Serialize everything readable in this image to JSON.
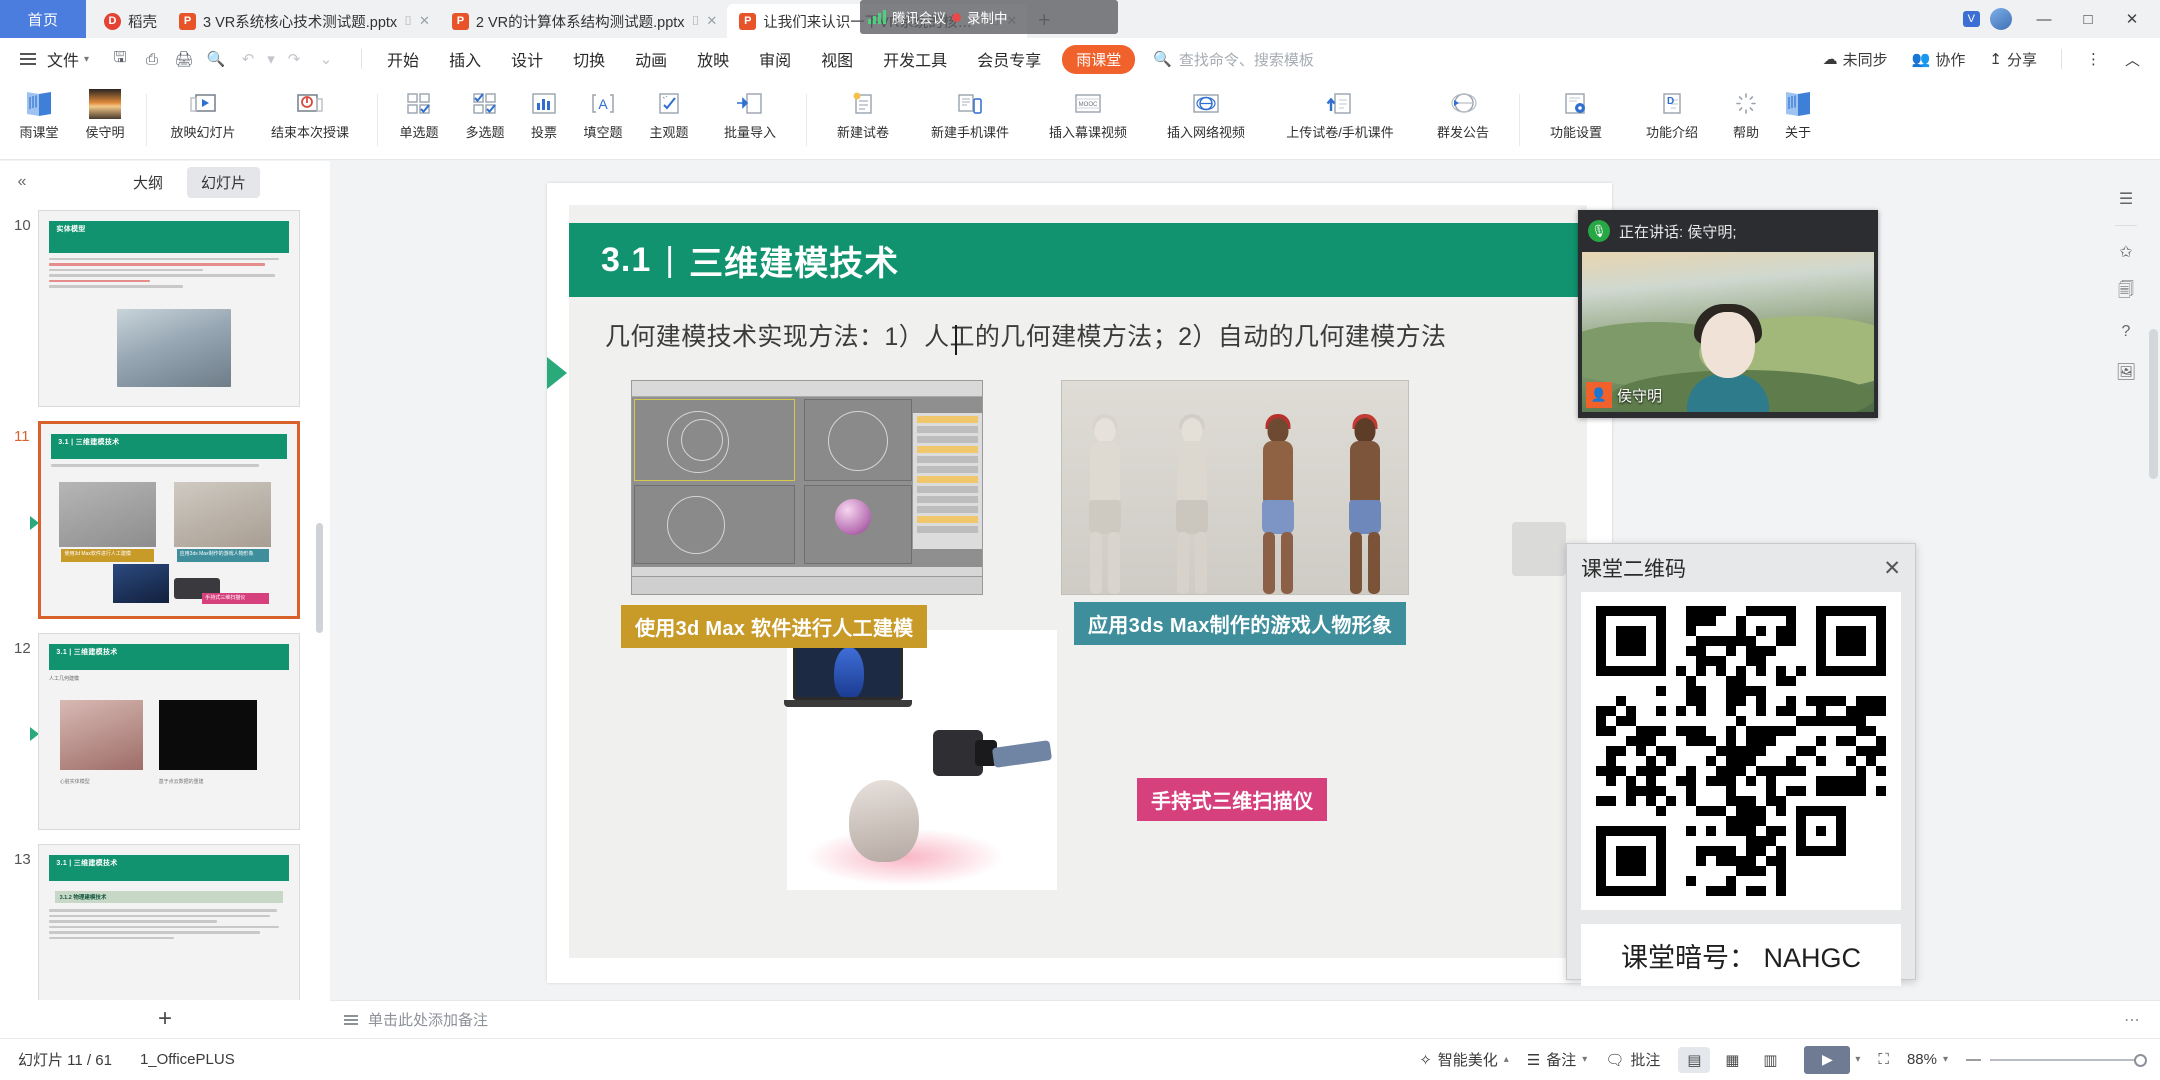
{
  "window": {
    "home_tab": "首页",
    "tabs": [
      {
        "icon": "wps-icon",
        "label": "稻壳",
        "active": false
      },
      {
        "icon": "ppt-icon",
        "label": "3 VR系统核心技术测试题.pptx",
        "active": false
      },
      {
        "icon": "ppt-icon",
        "label": "2 VR的计算体系结构测试题.pptx",
        "active": false
      },
      {
        "icon": "ppt-icon",
        "label": "让我们来认识一下VR系统的核心技术",
        "active": true
      }
    ],
    "new_tab": "+",
    "controls": {
      "minimize": "—",
      "maximize": "□",
      "close": "✕"
    },
    "vip_badge": "V"
  },
  "meeting_overlay": {
    "title": "腾讯会议",
    "status": "录制中"
  },
  "menubar": {
    "file": "文件",
    "quick_icons": [
      "save-icon",
      "print-preview-icon",
      "print-icon",
      "find-icon",
      "undo-icon",
      "redo-icon",
      "customize-icon"
    ],
    "items": [
      "开始",
      "插入",
      "设计",
      "切换",
      "动画",
      "放映",
      "审阅",
      "视图",
      "开发工具",
      "会员专享"
    ],
    "brand_tab": "雨课堂",
    "search_placeholder": "查找命令、搜索模板",
    "right_items": [
      {
        "icon": "cloud-icon",
        "label": "未同步"
      },
      {
        "icon": "collab-icon",
        "label": "协作"
      },
      {
        "icon": "share-icon",
        "label": "分享"
      }
    ],
    "more": "⋮",
    "collapse": "︿"
  },
  "ribbon": {
    "groups": [
      {
        "items": [
          {
            "label": "雨课堂",
            "icon": "book-icon"
          },
          {
            "label": "侯守明",
            "icon": "avatar-photo-icon"
          }
        ]
      },
      {
        "items": [
          {
            "label": "放映幻灯片",
            "icon": "play-slide-icon"
          },
          {
            "label": "结束本次授课",
            "icon": "stop-class-icon"
          }
        ]
      },
      {
        "items": [
          {
            "label": "单选题",
            "icon": "single-choice-icon"
          },
          {
            "label": "多选题",
            "icon": "multi-choice-icon"
          },
          {
            "label": "投票",
            "icon": "vote-chart-icon"
          },
          {
            "label": "填空题",
            "icon": "fill-blank-icon"
          },
          {
            "label": "主观题",
            "icon": "subjective-icon"
          },
          {
            "label": "批量导入",
            "icon": "batch-import-icon"
          }
        ]
      },
      {
        "items": [
          {
            "label": "新建试卷",
            "icon": "new-paper-icon"
          },
          {
            "label": "新建手机课件",
            "icon": "mobile-courseware-icon"
          },
          {
            "label": "插入幕课视频",
            "icon": "mooc-video-icon"
          },
          {
            "label": "插入网络视频",
            "icon": "web-video-icon"
          },
          {
            "label": "上传试卷/手机课件",
            "icon": "upload-icon"
          },
          {
            "label": "群发公告",
            "icon": "broadcast-icon"
          }
        ]
      },
      {
        "items": [
          {
            "label": "功能设置",
            "icon": "settings-icon"
          },
          {
            "label": "功能介绍",
            "icon": "intro-icon"
          },
          {
            "label": "帮助",
            "icon": "help-icon"
          },
          {
            "label": "关于",
            "icon": "about-icon"
          }
        ]
      }
    ]
  },
  "panel": {
    "collapse_icon": "«",
    "tabs": [
      {
        "label": "大纲",
        "active": false
      },
      {
        "label": "幻灯片",
        "active": true
      }
    ],
    "add_slide": "+",
    "thumbnails": [
      {
        "number": "10",
        "title": "实体模型",
        "selected": false,
        "kind": "text-photo"
      },
      {
        "number": "11",
        "title": "3.1 | 三维建模技术",
        "selected": true,
        "kind": "modeling"
      },
      {
        "number": "12",
        "title": "3.1 | 三维建模技术",
        "subtitle": "人工几何建模",
        "selected": false,
        "kind": "heart"
      },
      {
        "number": "13",
        "title": "3.1 | 三维建模技术",
        "subtitle": "3.1.2 物理建模技术",
        "selected": false,
        "kind": "text"
      }
    ]
  },
  "slide": {
    "section_number": "3.1",
    "divider": "|",
    "title": "三维建模技术",
    "body_text": "几何建模技术实现方法：1）人工的几何建模方法；2）自动的几何建模方法",
    "captions": [
      {
        "text": "使用3d Max 软件进行人工建模",
        "color": "#c89a28",
        "name": "caption-3dmax"
      },
      {
        "text": "应用3ds Max制作的游戏人物形象",
        "color": "#3f8e9b",
        "name": "caption-game-characters"
      },
      {
        "text": "手持式三维扫描仪",
        "color": "#d6407c",
        "name": "caption-handheld-scanner"
      }
    ],
    "images": [
      {
        "name": "3dmax-software-screenshot"
      },
      {
        "name": "game-characters-image"
      },
      {
        "name": "handheld-scanner-image"
      }
    ]
  },
  "video_panel": {
    "speaking_label": "正在讲话: 侯守明;",
    "speaker_name": "侯守明",
    "mic_icon": "mic-icon"
  },
  "qr_panel": {
    "title": "课堂二维码",
    "close": "✕",
    "code_label": "课堂暗号：",
    "code_value": "NAHGC",
    "code_full": "课堂暗号： NAHGC"
  },
  "notes": {
    "placeholder": "单击此处添加备注",
    "icon": "notes-icon",
    "more": "⋯"
  },
  "statusbar": {
    "slide_counter": "幻灯片 11 / 61",
    "template_name": "1_OfficePLUS",
    "beautify": "智能美化",
    "notes_btn": "备注",
    "comment_btn": "批注",
    "views": [
      {
        "name": "normal-view",
        "icon": "▤",
        "active": true
      },
      {
        "name": "slide-sorter-view",
        "icon": "▦",
        "active": false
      },
      {
        "name": "reading-view",
        "icon": "▥",
        "active": false
      }
    ],
    "play_button": "▶",
    "fit_icon": "⛶",
    "zoom": "88%",
    "zoom_minus": "—",
    "zoom_plus": "+"
  },
  "rail": {
    "icons": [
      "list-icon",
      "pin-icon",
      "copy-icon",
      "help-circle-icon",
      "image-icon"
    ]
  },
  "colors": {
    "brand_orange": "#f0612c",
    "slide_green": "#10936e",
    "selected_border": "#d9622b",
    "home_blue": "#4a7dde",
    "caption_gold": "#c89a28",
    "caption_teal": "#3f8e9b",
    "caption_pink": "#d6407c"
  }
}
